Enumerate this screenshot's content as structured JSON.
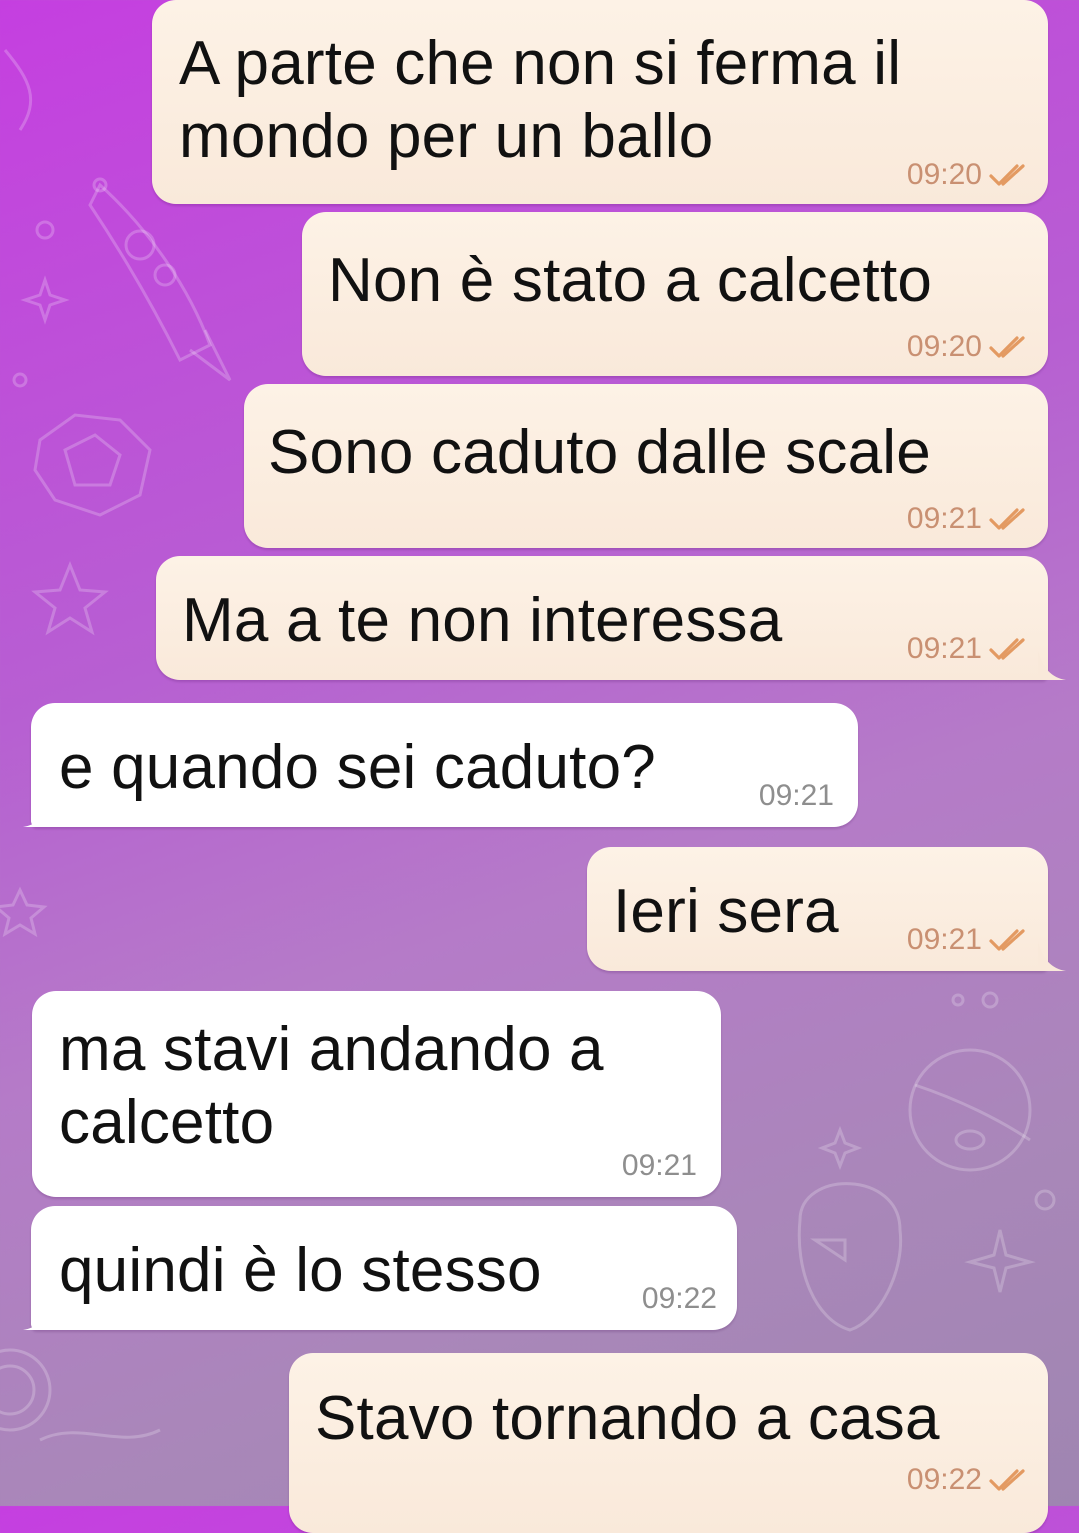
{
  "chat": {
    "messages": [
      {
        "direction": "out",
        "text_lines": [
          "A parte che non si ferma il",
          "mondo per un ballo"
        ],
        "time": "09:20",
        "status": "read-double-check"
      },
      {
        "direction": "out",
        "text_lines": [
          "Non è stato a calcetto"
        ],
        "time": "09:20",
        "status": "read-double-check"
      },
      {
        "direction": "out",
        "text_lines": [
          "Sono caduto dalle scale"
        ],
        "time": "09:21",
        "status": "read-double-check"
      },
      {
        "direction": "out",
        "text_lines": [
          "Ma a te non interessa"
        ],
        "time": "09:21",
        "status": "read-double-check"
      },
      {
        "direction": "in",
        "text_lines": [
          "e quando sei caduto?"
        ],
        "time": "09:21"
      },
      {
        "direction": "out",
        "text_lines": [
          "Ieri sera"
        ],
        "time": "09:21",
        "status": "read-double-check"
      },
      {
        "direction": "in",
        "text_lines": [
          "ma stavi andando a",
          "calcetto"
        ],
        "time": "09:21"
      },
      {
        "direction": "in",
        "text_lines": [
          "quindi è lo stesso"
        ],
        "time": "09:22"
      },
      {
        "direction": "out",
        "text_lines": [
          "Stavo tornando a casa"
        ],
        "time": "09:22",
        "status": "read-double-check"
      }
    ]
  },
  "colors": {
    "outgoing_bubble": "#fbeee0",
    "incoming_bubble": "#ffffff",
    "outgoing_time": "#c99072",
    "incoming_time": "#8e8e8e",
    "read_check": "#e39a62",
    "background_top": "#c53fe0",
    "background_bottom": "#9f85b1"
  }
}
